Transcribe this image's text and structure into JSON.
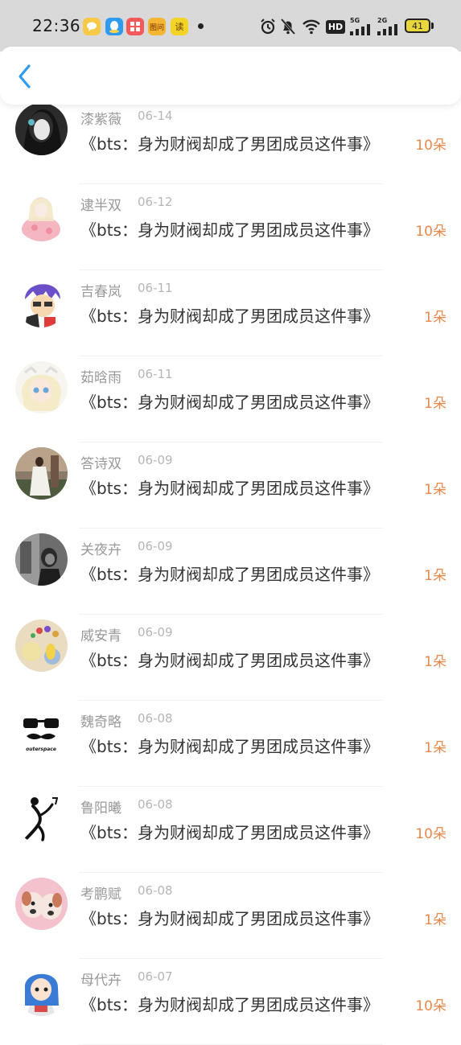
{
  "status_bar": {
    "time": "22:36",
    "battery": "41",
    "signal_label_1": "5G",
    "signal_label_2": "2G",
    "hd_label": "HD",
    "app_icons": [
      "chat-bubble-app-icon",
      "qq-penguin-icon",
      "shopping-app-icon",
      "news-app-icon",
      "reader-app-icon"
    ],
    "app_icon_labels": [
      "",
      "",
      "",
      "图问",
      "读"
    ],
    "app_icon_colors": [
      "#f7c948",
      "#2e9bf0",
      "#f15a5a",
      "#f2b632",
      "#f4d327"
    ]
  },
  "header": {
    "back_icon": "chevron-left-icon",
    "accent_color": "#2e9bf0"
  },
  "colors": {
    "amount": "#e8884a",
    "name": "#999999",
    "title": "#333333"
  },
  "records": [
    {
      "name": "漆紫薇",
      "date": "06-14",
      "title": "《bts：身为财阀却成了男团成员这件事》",
      "amount": "10朵"
    },
    {
      "name": "逮半双",
      "date": "06-12",
      "title": "《bts：身为财阀却成了男团成员这件事》",
      "amount": "10朵"
    },
    {
      "name": "吉春岚",
      "date": "06-11",
      "title": "《bts：身为财阀却成了男团成员这件事》",
      "amount": "1朵"
    },
    {
      "name": "茹晗雨",
      "date": "06-11",
      "title": "《bts：身为财阀却成了男团成员这件事》",
      "amount": "1朵"
    },
    {
      "name": "答诗双",
      "date": "06-09",
      "title": "《bts：身为财阀却成了男团成员这件事》",
      "amount": "1朵"
    },
    {
      "name": "关夜卉",
      "date": "06-09",
      "title": "《bts：身为财阀却成了男团成员这件事》",
      "amount": "1朵"
    },
    {
      "name": "威安青",
      "date": "06-09",
      "title": "《bts：身为财阀却成了男团成员这件事》",
      "amount": "1朵"
    },
    {
      "name": "魏奇略",
      "date": "06-08",
      "title": "《bts：身为财阀却成了男团成员这件事》",
      "amount": "1朵"
    },
    {
      "name": "鲁阳曦",
      "date": "06-08",
      "title": "《bts：身为财阀却成了男团成员这件事》",
      "amount": "10朵"
    },
    {
      "name": "考鹏赋",
      "date": "06-08",
      "title": "《bts：身为财阀却成了男团成员这件事》",
      "amount": "1朵"
    },
    {
      "name": "母代卉",
      "date": "06-07",
      "title": "《bts：身为财阀却成了男团成员这件事》",
      "amount": "10朵"
    }
  ],
  "avatar_logo_text": "outerspace"
}
